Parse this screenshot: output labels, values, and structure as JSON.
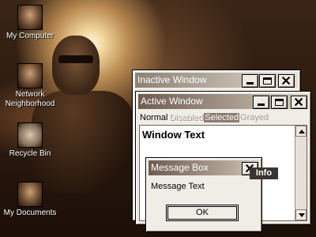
{
  "desktop": {
    "icons": [
      {
        "label": "My Computer"
      },
      {
        "label": "Network Neighborhood"
      },
      {
        "label": "Recycle Bin"
      },
      {
        "label": "My Documents"
      }
    ]
  },
  "inactive_window": {
    "title": "Inactive Window",
    "buttons": {
      "minimize": "minimize",
      "maximize": "maximize",
      "close": "close"
    }
  },
  "active_window": {
    "title": "Active Window",
    "states": {
      "normal": "Normal",
      "disabled": "Disabled",
      "selected": "Selected",
      "grayed": "Grayed"
    },
    "window_text": "Window Text"
  },
  "message_box": {
    "title": "Message Box",
    "text": "Message Text",
    "ok_label": "OK"
  },
  "tooltip": {
    "text": "Info"
  },
  "colors": {
    "active_title_start": "#6e5c50",
    "inactive_title_start": "#8d8176",
    "selected_bg": "#8a7c70",
    "window_bg": "#f0ece6"
  }
}
